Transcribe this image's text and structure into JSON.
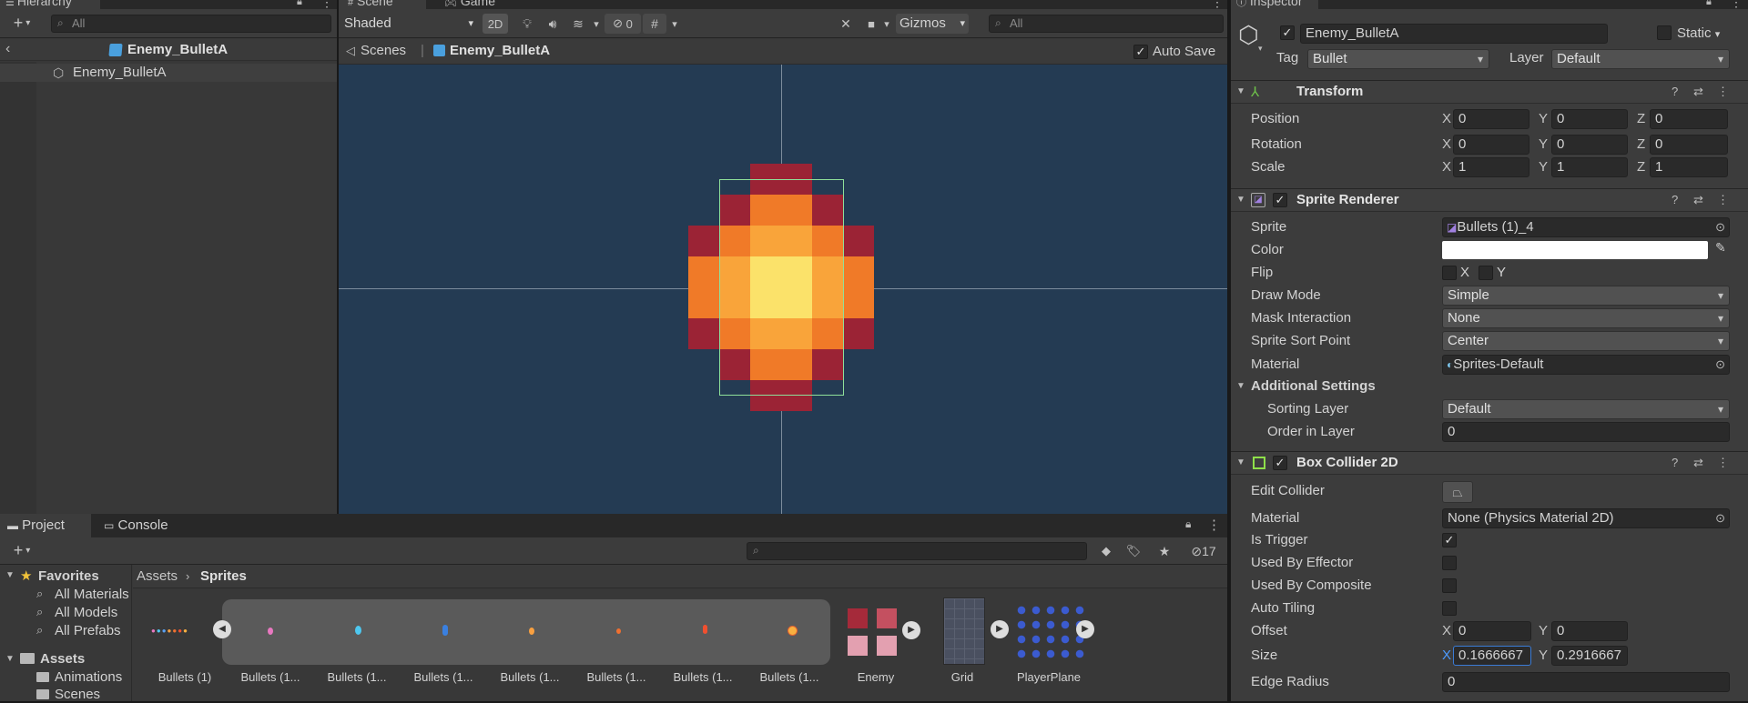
{
  "hierarchy": {
    "tab": "Hierarchy",
    "search_placeholder": "All",
    "breadcrumb": "Enemy_BulletA",
    "item": "Enemy_BulletA"
  },
  "scene": {
    "tab_scene": "Scene",
    "tab_game": "Game",
    "shading_mode": "Shaded",
    "mode_2d": "2D",
    "hidden_count": "0",
    "gizmos": "Gizmos",
    "search_placeholder": "All",
    "breadcrumb_root": "Scenes",
    "breadcrumb_current": "Enemy_BulletA",
    "auto_save": "Auto Save",
    "colors": {
      "background": "#243B53",
      "dark_red": "#9B2335",
      "orange": "#F07A28",
      "light_orange": "#F9A43A",
      "yellow": "#FBE26A"
    }
  },
  "project": {
    "tab_project": "Project",
    "tab_console": "Console",
    "hidden_count": "17",
    "breadcrumb_root": "Assets",
    "breadcrumb_current": "Sprites",
    "favorites": {
      "label": "Favorites",
      "items": [
        "All Materials",
        "All Models",
        "All Prefabs"
      ]
    },
    "assets": {
      "label": "Assets",
      "items": [
        "Animations",
        "Scenes"
      ]
    },
    "asset_items": [
      "Bullets (1)",
      "Bullets (1...",
      "Bullets (1...",
      "Bullets (1...",
      "Bullets (1...",
      "Bullets (1...",
      "Bullets (1...",
      "Bullets (1...",
      "Enemy",
      "Grid",
      "PlayerPlane"
    ]
  },
  "inspector": {
    "tab": "Inspector",
    "object_name": "Enemy_BulletA",
    "static_label": "Static",
    "tag_label": "Tag",
    "tag_value": "Bullet",
    "layer_label": "Layer",
    "layer_value": "Default",
    "transform": {
      "title": "Transform",
      "position_label": "Position",
      "position": [
        "0",
        "0",
        "0"
      ],
      "rotation_label": "Rotation",
      "rotation": [
        "0",
        "0",
        "0"
      ],
      "scale_label": "Scale",
      "scale": [
        "1",
        "1",
        "1"
      ]
    },
    "sprite_renderer": {
      "title": "Sprite Renderer",
      "sprite_label": "Sprite",
      "sprite_value": "Bullets (1)_4",
      "color_label": "Color",
      "flip_label": "Flip",
      "flip_x": "X",
      "flip_y": "Y",
      "draw_mode_label": "Draw Mode",
      "draw_mode_value": "Simple",
      "mask_label": "Mask Interaction",
      "mask_value": "None",
      "sort_point_label": "Sprite Sort Point",
      "sort_point_value": "Center",
      "material_label": "Material",
      "material_value": "Sprites-Default",
      "additional_label": "Additional Settings",
      "sorting_layer_label": "Sorting Layer",
      "sorting_layer_value": "Default",
      "order_label": "Order in Layer",
      "order_value": "0"
    },
    "box_collider": {
      "title": "Box Collider 2D",
      "edit_label": "Edit Collider",
      "material_label": "Material",
      "material_value": "None (Physics Material 2D)",
      "trigger_label": "Is Trigger",
      "effector_label": "Used By Effector",
      "composite_label": "Used By Composite",
      "tiling_label": "Auto Tiling",
      "offset_label": "Offset",
      "offset": [
        "0",
        "0"
      ],
      "size_label": "Size",
      "size": [
        "0.1666667",
        "0.2916667"
      ],
      "edge_label": "Edge Radius",
      "edge_value": "0"
    },
    "axes": {
      "x": "X",
      "y": "Y",
      "z": "Z"
    }
  }
}
